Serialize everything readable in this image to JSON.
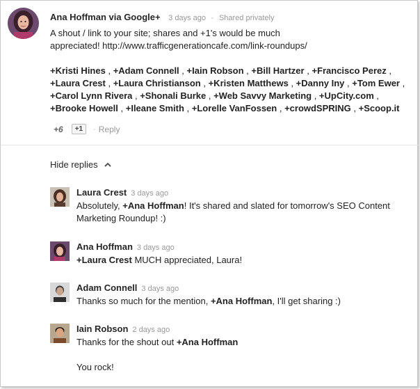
{
  "post": {
    "author": "Ana Hoffman",
    "via": "via Google+",
    "time": "3 days ago",
    "separator": "-",
    "visibility": "Shared privately",
    "text_line1": "A shout / link to your site; shares and +1's would be much",
    "text_line2": "appreciated! http://www.trafficgenerationcafe.com/link-roundups/",
    "mentions": [
      "+Kristi Hines",
      "+Adam Connell",
      "+Iain Robson",
      "+Bill Hartzer",
      "+Francisco Perez",
      "+Laura Crest",
      "+Laura Christianson",
      "+Kristen Matthews",
      "+Danny Iny",
      "+Tom Ewer",
      "+Carol Lynn Rivera",
      "+Shonali Burke",
      "+Web Savvy Marketing",
      "+UpCity.com",
      "+Brooke Howell",
      "+Ileane Smith",
      "+Lorelle VanFossen",
      "+crowdSPRING",
      "+Scoop.it"
    ],
    "plus_count": "+6",
    "plus_one_label": "+1",
    "action_sep": "·",
    "reply_label": "Reply"
  },
  "replies_toggle": {
    "label": "Hide replies"
  },
  "replies": [
    {
      "name": "Laura Crest",
      "time": "3 days ago",
      "pre": "Absolutely, ",
      "mention": "+Ana Hoffman",
      "post_line1": "! It's shared and slated for tomorrow's SEO Content",
      "post_line2": "Marketing Roundup! :)"
    },
    {
      "name": "Ana Hoffman",
      "time": "3 days ago",
      "mention": "+Laura Crest",
      "post": " MUCH appreciated, Laura!"
    },
    {
      "name": "Adam Connell",
      "time": "3 days ago",
      "pre": "Thanks so much for the mention, ",
      "mention": "+Ana Hoffman",
      "post": ", I'll get sharing :)"
    },
    {
      "name": "Iain Robson",
      "time": "2 days ago",
      "pre": "Thanks for the shout out ",
      "mention": "+Ana Hoffman",
      "line2": "You rock!"
    }
  ]
}
